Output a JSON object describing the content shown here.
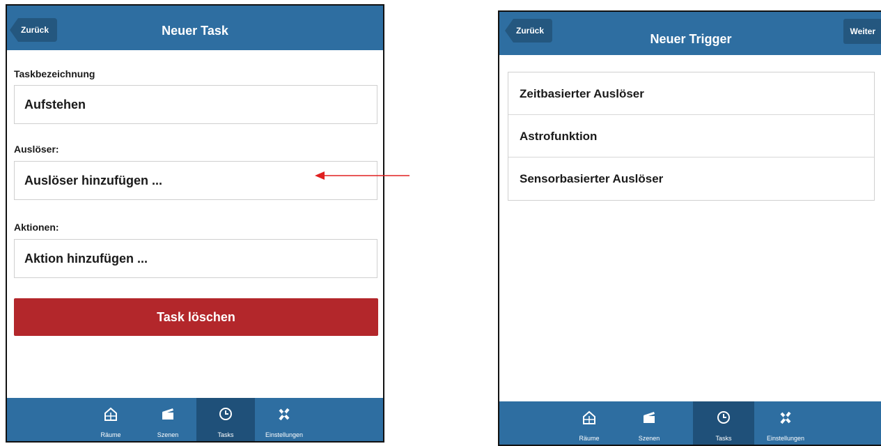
{
  "colors": {
    "navbar": "#2e6ea1",
    "navbar_button": "#24577f",
    "tab_active": "#1f5079",
    "delete": "#b3272b",
    "annotation_arrow": "#e02020"
  },
  "left_screen": {
    "back_label": "Zurück",
    "title": "Neuer Task",
    "task_name": {
      "label": "Taskbezeichnung",
      "value": "Aufstehen"
    },
    "trigger": {
      "label": "Auslöser:",
      "value": "Auslöser hinzufügen ..."
    },
    "actions": {
      "label": "Aktionen:",
      "value": "Aktion hinzufügen ..."
    },
    "delete_label": "Task löschen"
  },
  "right_screen": {
    "back_label": "Zurück",
    "title": "Neuer Trigger",
    "next_label": "Weiter",
    "trigger_options": [
      "Zeitbasierter Auslöser",
      "Astrofunktion",
      "Sensorbasierter Auslöser"
    ]
  },
  "tabbar": {
    "active": "Tasks",
    "items": [
      {
        "label": "Räume",
        "icon": "house-icon"
      },
      {
        "label": "Szenen",
        "icon": "clapperboard-icon"
      },
      {
        "label": "Tasks",
        "icon": "clock-icon"
      },
      {
        "label": "Einstellungen",
        "icon": "tools-icon"
      }
    ]
  }
}
